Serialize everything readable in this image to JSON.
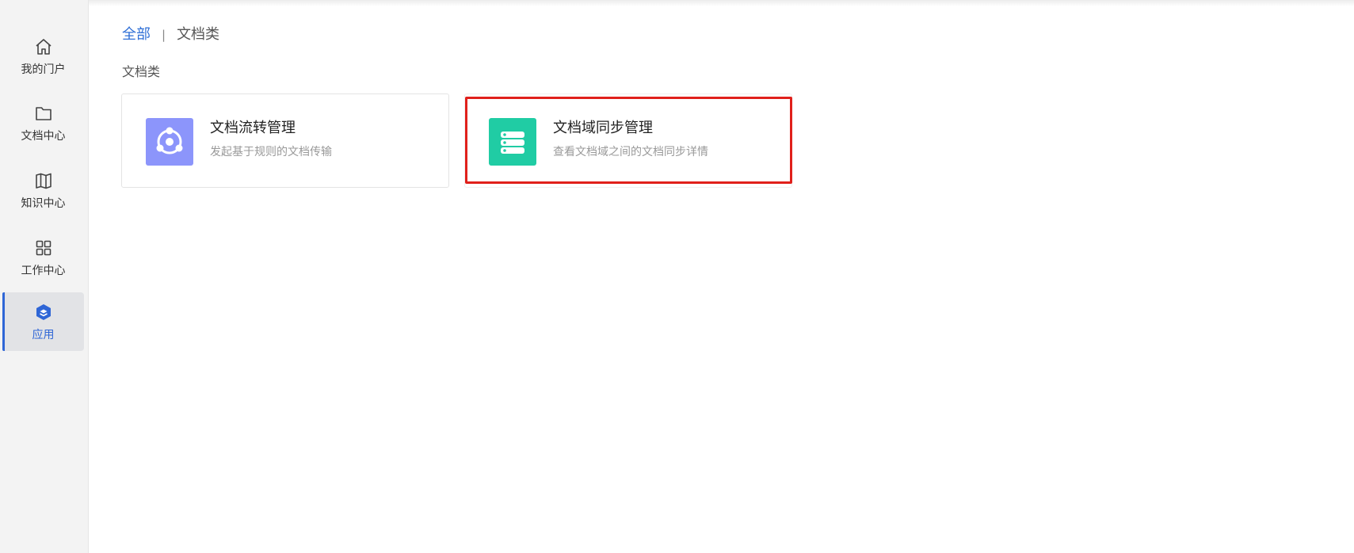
{
  "sidebar": {
    "items": [
      {
        "label": "我的门户",
        "icon": "home-icon"
      },
      {
        "label": "文档中心",
        "icon": "folder-icon"
      },
      {
        "label": "知识中心",
        "icon": "book-map-icon"
      },
      {
        "label": "工作中心",
        "icon": "grid-icon"
      },
      {
        "label": "应用",
        "icon": "apps-logo-icon",
        "active": true
      }
    ],
    "active_color": "#2f66d6"
  },
  "breadcrumb": {
    "root": "全部",
    "separator": "|",
    "current": "文档类"
  },
  "section": {
    "title": "文档类"
  },
  "cards": [
    {
      "title": "文档流转管理",
      "description": "发起基于规则的文档传输",
      "icon": "document-flow-icon",
      "icon_color": "#8c95fb"
    },
    {
      "title": "文档域同步管理",
      "description": "查看文档域之间的文档同步详情",
      "icon": "server-stack-icon",
      "icon_color": "#20cca4",
      "highlighted": true,
      "highlight_color": "#e0201b"
    }
  ]
}
